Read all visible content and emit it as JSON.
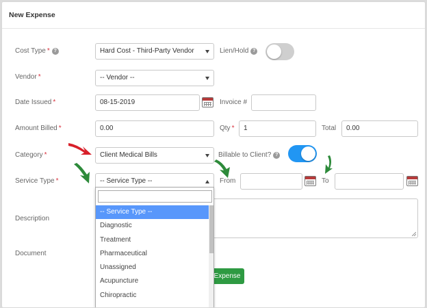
{
  "header": {
    "title": "New Expense"
  },
  "colors": {
    "toggle_on": "#2196f3",
    "toggle_off": "#cfcfcf",
    "primary_green": "#2e9a42",
    "dropdown_highlight": "#5897fb",
    "arrow_red": "#d8202a",
    "arrow_green": "#2d8a3a"
  },
  "form": {
    "cost_type": {
      "label": "Cost Type",
      "value": "Hard Cost - Third-Party Vendor"
    },
    "lien_hold": {
      "label": "Lien/Hold",
      "on": false
    },
    "vendor": {
      "label": "Vendor",
      "value": "-- Vendor --"
    },
    "date_issued": {
      "label": "Date Issued",
      "value": "08-15-2019"
    },
    "invoice": {
      "label": "Invoice #",
      "value": ""
    },
    "amount_billed": {
      "label": "Amount Billed",
      "value": "0.00"
    },
    "qty": {
      "label": "Qty",
      "value": "1"
    },
    "total": {
      "label": "Total",
      "value": "0.00"
    },
    "category": {
      "label": "Category",
      "value": "Client Medical Bills"
    },
    "billable": {
      "label": "Billable to Client?",
      "on": true
    },
    "service_type": {
      "label": "Service Type",
      "value": "-- Service Type --"
    },
    "from": {
      "label": "From",
      "value": ""
    },
    "to": {
      "label": "To",
      "value": ""
    },
    "description": {
      "label": "Description"
    },
    "document": {
      "label": "Document"
    },
    "submit_label": "Expense"
  },
  "dropdown": {
    "search_value": "",
    "options": [
      "-- Service Type --",
      "Diagnostic",
      "Treatment",
      "Pharmaceutical",
      "Unassigned",
      "Acupuncture",
      "Chiropractic"
    ],
    "selected_index": 0
  },
  "icons": {
    "help": "question-circle-icon",
    "calendar": "calendar-icon",
    "annotation": "annotation-arrow-icon"
  }
}
